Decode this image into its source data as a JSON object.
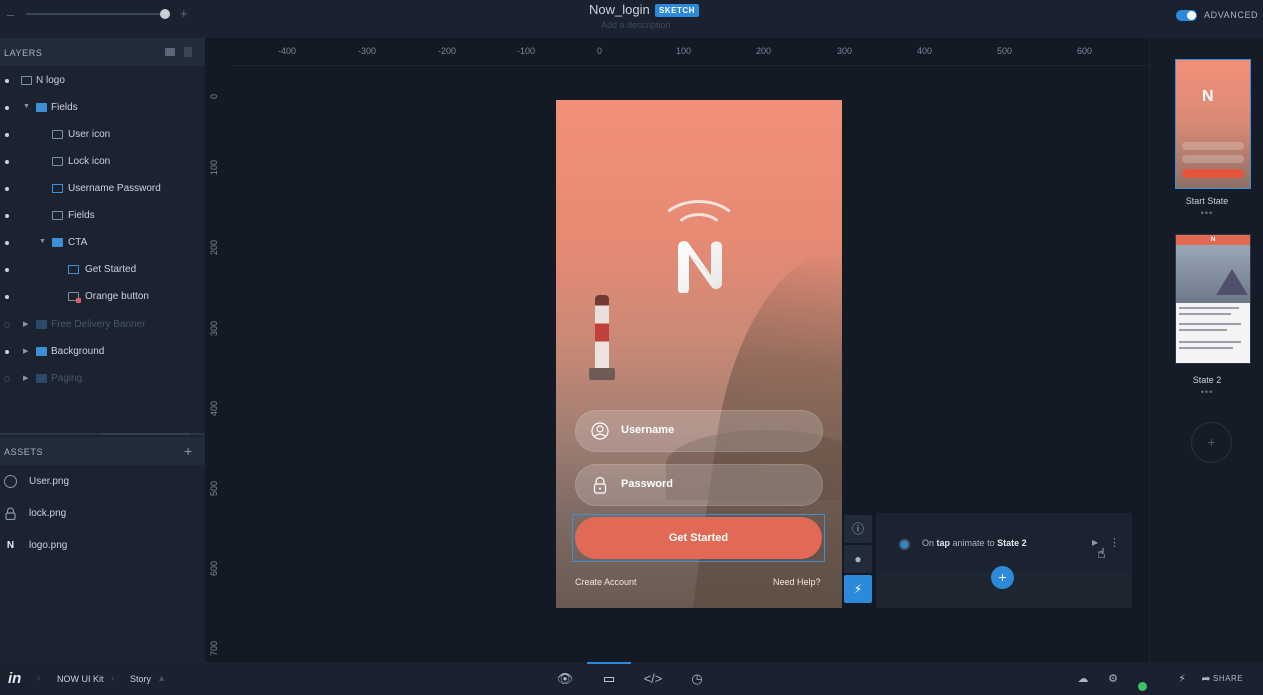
{
  "topbar": {
    "zoom_minus": "–",
    "zoom_plus": "+",
    "title": "Now_login",
    "badge": "SKETCH",
    "description_placeholder": "Add a description",
    "advanced_label": "ADVANCED",
    "advanced_on": true
  },
  "layers": {
    "header": "LAYERS",
    "items": [
      {
        "label": "N logo",
        "icon": "image-icon"
      },
      {
        "label": "Fields",
        "icon": "folder-icon"
      },
      {
        "label": "User icon",
        "icon": "image-icon"
      },
      {
        "label": "Lock icon",
        "icon": "image-icon"
      },
      {
        "label": "Username  Password",
        "icon": "text-icon"
      },
      {
        "label": "Fields",
        "icon": "image-icon"
      },
      {
        "label": "CTA",
        "icon": "folder-icon"
      },
      {
        "label": "Get Started",
        "icon": "text-icon"
      },
      {
        "label": "Orange button",
        "icon": "shape-icon"
      },
      {
        "label": "Free Delivery Banner",
        "icon": "folder-icon"
      },
      {
        "label": "Background",
        "icon": "folder-icon"
      },
      {
        "label": "Paging",
        "icon": "folder-icon"
      }
    ]
  },
  "assets": {
    "header": "ASSETS",
    "add": "+",
    "items": [
      {
        "label": "User.png",
        "icon": "user-icon"
      },
      {
        "label": "lock.png",
        "icon": "lock-icon"
      },
      {
        "label": "logo.png",
        "icon": "logo-icon",
        "glyph": "N"
      }
    ]
  },
  "ruler": {
    "horizontal": [
      "-400",
      "-300",
      "-200",
      "-100",
      "0",
      "100",
      "200",
      "300",
      "400",
      "500",
      "600"
    ],
    "vertical": [
      "0",
      "100",
      "200",
      "300",
      "400",
      "500",
      "600",
      "700"
    ]
  },
  "phone": {
    "username": "Username",
    "password": "Password",
    "cta": "Get Started",
    "create_account": "Create Account",
    "need_help": "Need Help?"
  },
  "interaction": {
    "tools": [
      "info-icon",
      "drop-icon",
      "lightning-icon"
    ],
    "prefix": "On",
    "trigger": "tap",
    "action": "animate to",
    "target": "State 2",
    "add": "+",
    "more": "⋮"
  },
  "states": {
    "items": [
      {
        "label": "Start State",
        "dots": "•••"
      },
      {
        "label": "State 2",
        "dots": "•••",
        "mini_header": "N"
      }
    ],
    "add": "+"
  },
  "bottombar": {
    "logo": "in",
    "breadcrumb": [
      "NOW UI Kit",
      "Story"
    ],
    "share": "SHARE"
  },
  "colors": {
    "accent": "#2d8ad9",
    "cta": "#e06a55",
    "status": "#3ec26a"
  }
}
